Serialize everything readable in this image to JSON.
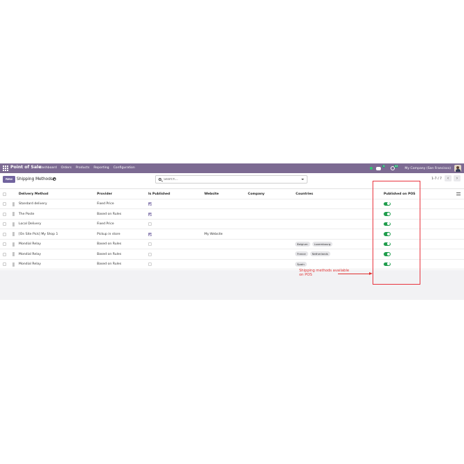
{
  "navbar": {
    "app_name": "Point of Sale",
    "menu": [
      "Dashboard",
      "Orders",
      "Products",
      "Reporting",
      "Configuration"
    ],
    "chat_badge": "5",
    "activity_badge": "43",
    "company": "My Company (San Francisco)"
  },
  "control": {
    "new_label": "New",
    "title": "Shipping Methods",
    "search_placeholder": "Search...",
    "pager": "1-7 / 7"
  },
  "table": {
    "columns": {
      "method": "Delivery Method",
      "provider": "Provider",
      "is_published": "Is Published",
      "website": "Website",
      "company": "Company",
      "countries": "Countries",
      "published_pos": "Published on POS"
    },
    "rows": [
      {
        "method": "Standard delivery",
        "provider": "Fixed Price",
        "published": true,
        "website": "",
        "countries": [],
        "pos": true
      },
      {
        "method": "The Poste",
        "provider": "Based on Rules",
        "published": true,
        "website": "",
        "countries": [],
        "pos": true
      },
      {
        "method": "Local Delivery",
        "provider": "Fixed Price",
        "published": false,
        "website": "",
        "countries": [],
        "pos": true
      },
      {
        "method": "[On Site Pick] My Shop 1",
        "provider": "Pickup in store",
        "published": true,
        "website": "My Website",
        "countries": [],
        "pos": true
      },
      {
        "method": "Mondial Relay",
        "provider": "Based on Rules",
        "published": false,
        "website": "",
        "countries": [
          "Belgium",
          "Luxembourg"
        ],
        "pos": true
      },
      {
        "method": "Mondial Relay",
        "provider": "Based on Rules",
        "published": false,
        "website": "",
        "countries": [
          "France",
          "Netherlands"
        ],
        "pos": true
      },
      {
        "method": "Mondial Relay",
        "provider": "Based on Rules",
        "published": false,
        "website": "",
        "countries": [
          "Spain"
        ],
        "pos": true
      }
    ]
  },
  "annotation": {
    "line1": "Shipping methods available",
    "line2": "on POS",
    "color": "#e03030"
  },
  "colors": {
    "navbar": "#7c6a92",
    "primary_button": "#71639e",
    "toggle_on": "#1f9d4c"
  }
}
